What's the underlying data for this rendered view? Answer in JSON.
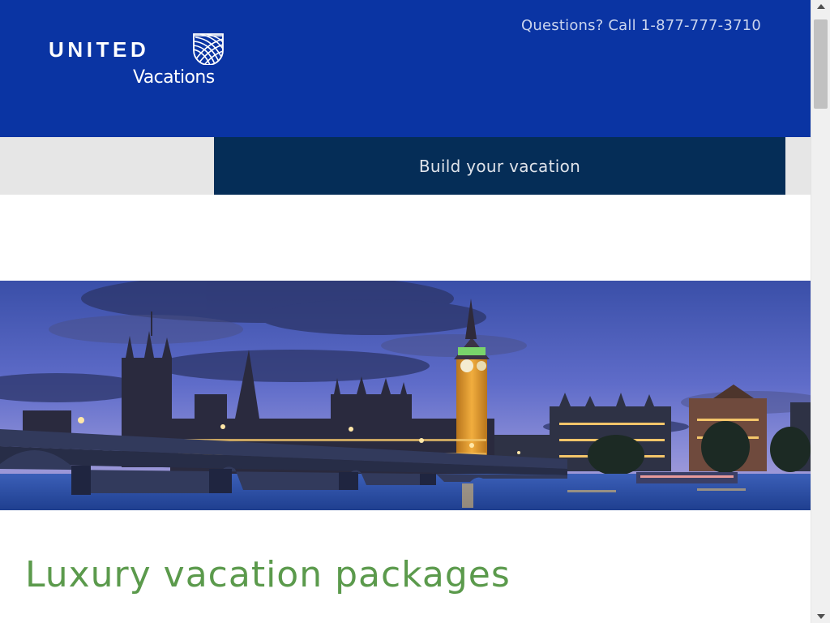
{
  "header": {
    "logo_word": "UNITED",
    "logo_sub": "Vacations",
    "phone": "Questions? Call 1-877-777-3710"
  },
  "nav": {
    "cta_label": "Build your vacation"
  },
  "hero": {
    "image": "london-skyline-dusk"
  },
  "main": {
    "heading": "Luxury vacation packages"
  },
  "colors": {
    "header_bg": "#0a34a3",
    "nav_button_bg": "#052d57",
    "nav_bar_bg": "#e6e6e6",
    "heading": "#5b9a4c"
  },
  "icons": {
    "logo_globe": "united-globe-icon",
    "scroll_up": "triangle-up-icon",
    "scroll_down": "triangle-down-icon"
  }
}
